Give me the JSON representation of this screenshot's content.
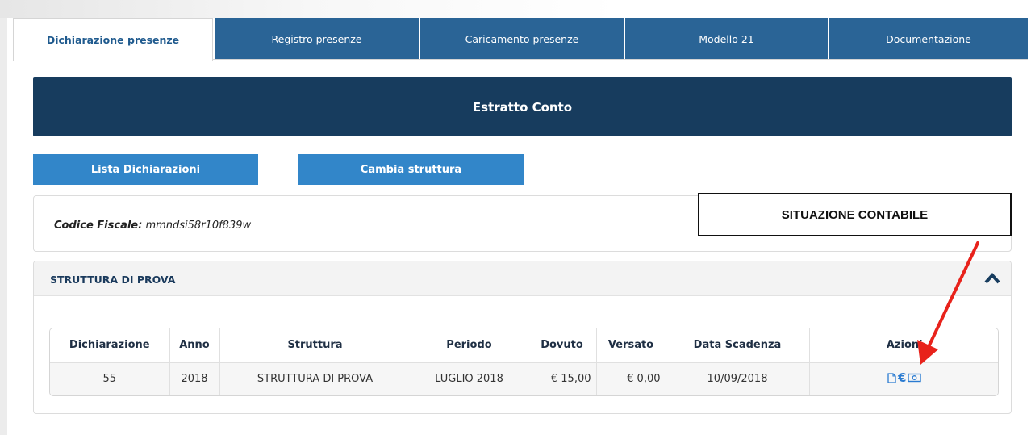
{
  "tabs": [
    {
      "label": "Dichiarazione presenze",
      "active": true
    },
    {
      "label": "Registro presenze",
      "active": false
    },
    {
      "label": "Caricamento presenze",
      "active": false
    },
    {
      "label": "Modello 21",
      "active": false
    },
    {
      "label": "Documentazione",
      "active": false
    }
  ],
  "banner": {
    "title": "Estratto Conto"
  },
  "buttons": {
    "lista": "Lista Dichiarazioni",
    "cambia": "Cambia struttura"
  },
  "fiscal": {
    "label": "Codice Fiscale:",
    "value": "mmndsi58r10f839w"
  },
  "annotation": {
    "text": "SITUAZIONE CONTABILE"
  },
  "structure": {
    "title": "STRUTTURA DI PROVA",
    "table": {
      "headers": [
        "Dichiarazione",
        "Anno",
        "Struttura",
        "Periodo",
        "Dovuto",
        "Versato",
        "Data Scadenza",
        "Azioni"
      ],
      "rows": [
        {
          "dichiarazione": "55",
          "anno": "2018",
          "struttura": "STRUTTURA DI PROVA",
          "periodo": "LUGLIO 2018",
          "dovuto": "€ 15,00",
          "versato": "€ 0,00",
          "scadenza": "10/09/2018",
          "actions": [
            "document-icon",
            "euro-icon",
            "banknote-icon"
          ]
        }
      ]
    }
  },
  "colors": {
    "tab": "#2a6496",
    "banner": "#173c5e",
    "button": "#3286c9",
    "arrow": "#e8221b",
    "icon": "#2a7bd1"
  }
}
